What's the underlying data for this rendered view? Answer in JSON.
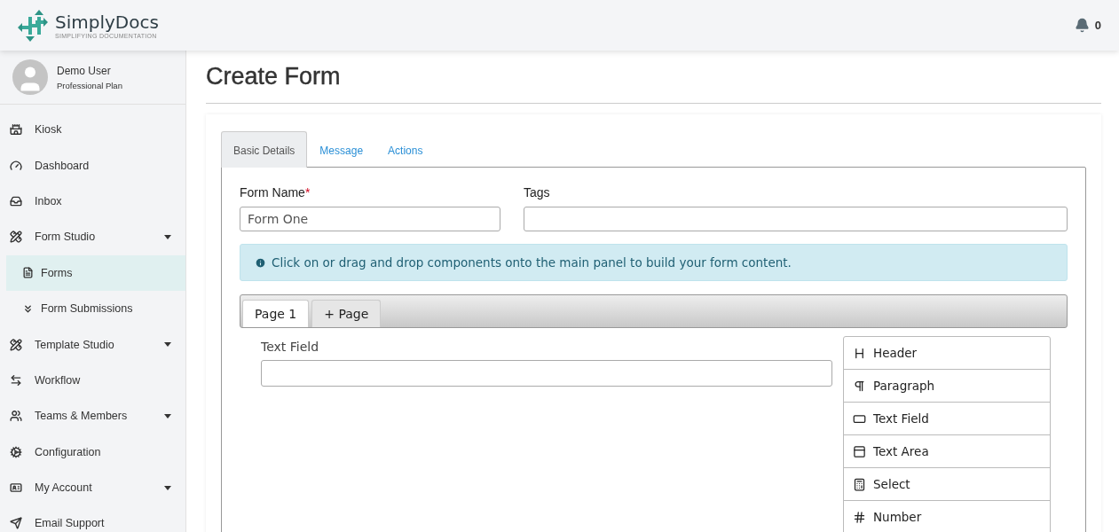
{
  "header": {
    "brand": "SimplyDocs",
    "tagline": "SIMPLIFYING DOCUMENTATION",
    "notification_count": "0"
  },
  "user": {
    "name": "Demo User",
    "plan": "Professional Plan"
  },
  "sidebar": {
    "items": [
      {
        "label": "Kiosk",
        "kind": "link",
        "selected": false
      },
      {
        "label": "Dashboard",
        "kind": "link",
        "selected": false
      },
      {
        "label": "Inbox",
        "kind": "link",
        "selected": false
      },
      {
        "label": "Form Studio",
        "kind": "menu",
        "selected": false,
        "children": [
          {
            "label": "Forms",
            "selected": true
          },
          {
            "label": "Form Submissions",
            "selected": false
          }
        ]
      },
      {
        "label": "Template Studio",
        "kind": "menu",
        "selected": false
      },
      {
        "label": "Workflow",
        "kind": "link",
        "selected": false
      },
      {
        "label": "Teams & Members",
        "kind": "menu",
        "selected": false
      },
      {
        "label": "Configuration",
        "kind": "link",
        "selected": false
      },
      {
        "label": "My Account",
        "kind": "menu",
        "selected": false
      },
      {
        "label": "Email Support",
        "kind": "link",
        "selected": false
      }
    ]
  },
  "page_title": "Create Form",
  "tabs": [
    {
      "label": "Basic Details",
      "selected": true
    },
    {
      "label": "Message",
      "selected": false
    },
    {
      "label": "Actions",
      "selected": false
    }
  ],
  "fields": [
    {
      "label": "Form Name",
      "required_mark": "*",
      "value": "Form One"
    },
    {
      "label": "Tags"
    }
  ],
  "info": "Click on or drag and drop components onto the main panel to build your form content.",
  "page_tabs": [
    {
      "label": "Page 1",
      "selected": true
    },
    {
      "label": "+ Page",
      "selected": false
    }
  ],
  "canvas_fields": [
    {
      "label": "Text Field"
    }
  ],
  "components": [
    "Header",
    "Paragraph",
    "Text Field",
    "Text Area",
    "Select",
    "Number"
  ]
}
